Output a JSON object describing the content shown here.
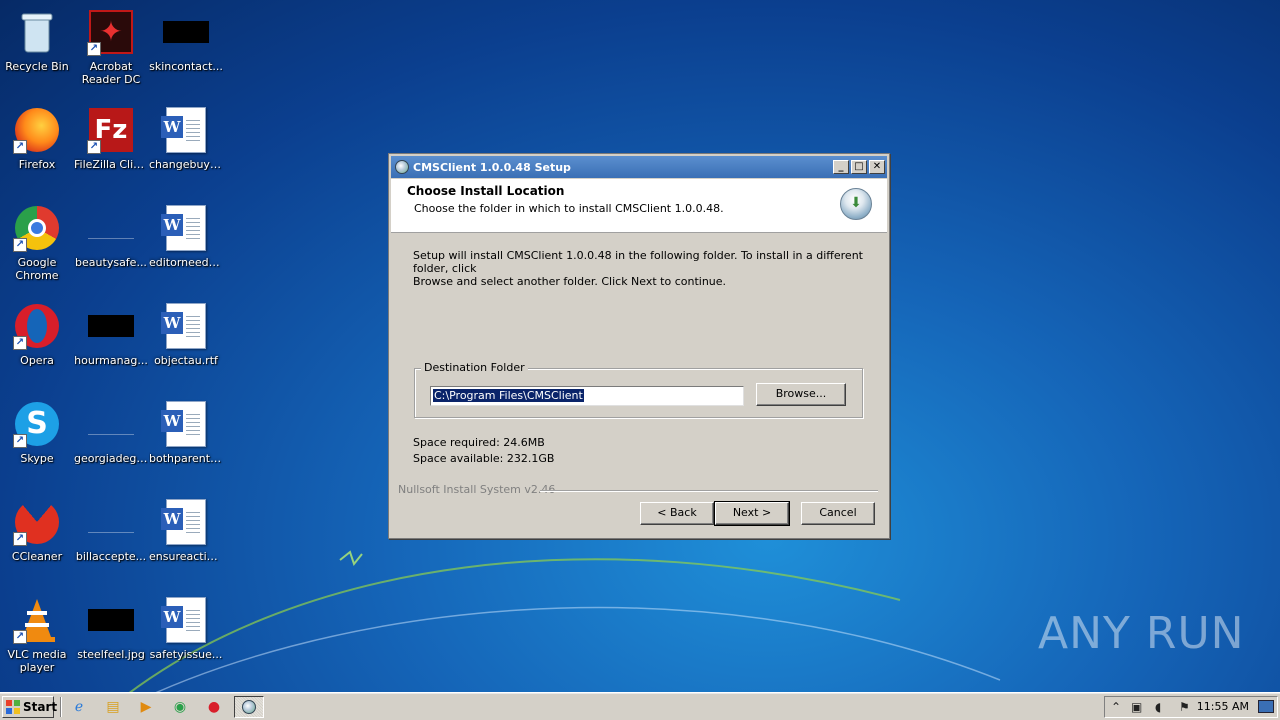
{
  "desktop": {
    "icons": [
      {
        "label": "Recycle Bin"
      },
      {
        "label": "Acrobat Reader DC"
      },
      {
        "label": "skincontact..."
      },
      {
        "label": "Firefox"
      },
      {
        "label": "FileZilla Client"
      },
      {
        "label": "changebuyi..."
      },
      {
        "label": "Google Chrome"
      },
      {
        "label": "beautysafe..."
      },
      {
        "label": "editorneed.rtf"
      },
      {
        "label": "Opera"
      },
      {
        "label": "hourmanag..."
      },
      {
        "label": "objectau.rtf"
      },
      {
        "label": "Skype"
      },
      {
        "label": "georgiadegr..."
      },
      {
        "label": "bothparent.rtf"
      },
      {
        "label": "CCleaner"
      },
      {
        "label": "billaccepte..."
      },
      {
        "label": "ensureactio..."
      },
      {
        "label": "VLC media player"
      },
      {
        "label": "steelfeel.jpg"
      },
      {
        "label": "safetyissue..."
      }
    ]
  },
  "dialog": {
    "title": "CMSClient 1.0.0.48 Setup",
    "header_title": "Choose Install Location",
    "header_subtitle": "Choose the folder in which to install CMSClient 1.0.0.48.",
    "body_line1": "Setup will install CMSClient 1.0.0.48 in the following folder. To install in a different folder, click",
    "body_line2": "Browse and select another folder. Click Next to continue.",
    "destination_label": "Destination Folder",
    "destination_path": "C:\\Program Files\\CMSClient",
    "browse_label": "Browse...",
    "space_required": "Space required: 24.6MB",
    "space_available": "Space available: 232.1GB",
    "branding": "Nullsoft Install System v2.46",
    "back_label": "< Back",
    "next_label": "Next >",
    "cancel_label": "Cancel"
  },
  "taskbar": {
    "start_label": "Start",
    "clock": "11:55 AM"
  },
  "watermark": "ANY RUN"
}
